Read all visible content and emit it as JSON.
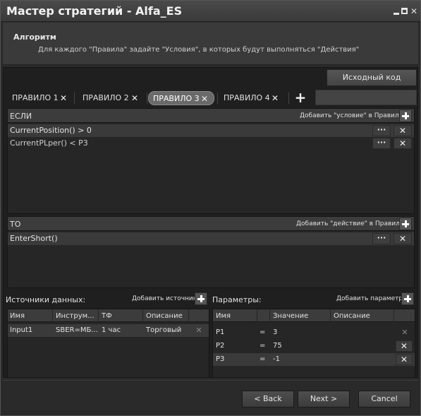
{
  "window": {
    "title": "Мастер стратегий - Alfa_ES"
  },
  "header": {
    "title": "Алгоритм",
    "subtitle": "Для каждого \"Правила\" задайте \"Условия\", в которых будут выполняться \"Действия\""
  },
  "source_button": "Исходный код",
  "tabs": [
    {
      "label": "ПРАВИЛО 1",
      "active": false
    },
    {
      "label": "ПРАВИЛО 2",
      "active": false
    },
    {
      "label": "ПРАВИЛО 3",
      "active": true
    },
    {
      "label": "ПРАВИЛО 4",
      "active": false
    }
  ],
  "tab_close_glyph": "✕",
  "tab_add_glyph": "+",
  "if_panel": {
    "label": "ЕСЛИ",
    "add_label": "Добавить \"условие\" в Правило",
    "rows": [
      {
        "text": "CurrentPosition() > 0",
        "selected": true
      },
      {
        "text": "CurrentPLper() < P3",
        "selected": false
      }
    ]
  },
  "then_panel": {
    "label": "ТО",
    "add_label": "Добавить \"действие\" в Правило",
    "rows": [
      {
        "text": "EnterShort()",
        "selected": true
      }
    ]
  },
  "row_dots": "···",
  "row_close": "✕",
  "sources": {
    "label": "Источники данных:",
    "add_label": "Добавить источник",
    "columns": [
      "Имя",
      "Инструм...",
      "ТФ",
      "Описание"
    ],
    "rows": [
      {
        "name": "Input1",
        "instrument": "SBER=МБ...",
        "tf": "1 час",
        "desc": "Торговый"
      }
    ]
  },
  "params": {
    "label": "Параметры:",
    "add_label": "Добавить параметр",
    "columns": [
      "Имя",
      "Значение",
      "Описание"
    ],
    "rows": [
      {
        "name": "P1",
        "eq": "=",
        "value": "3"
      },
      {
        "name": "P2",
        "eq": "=",
        "value": "75"
      },
      {
        "name": "P3",
        "eq": "=",
        "value": "-1"
      }
    ]
  },
  "footer": {
    "back": "< Back",
    "next": "Next >",
    "cancel": "Cancel"
  }
}
